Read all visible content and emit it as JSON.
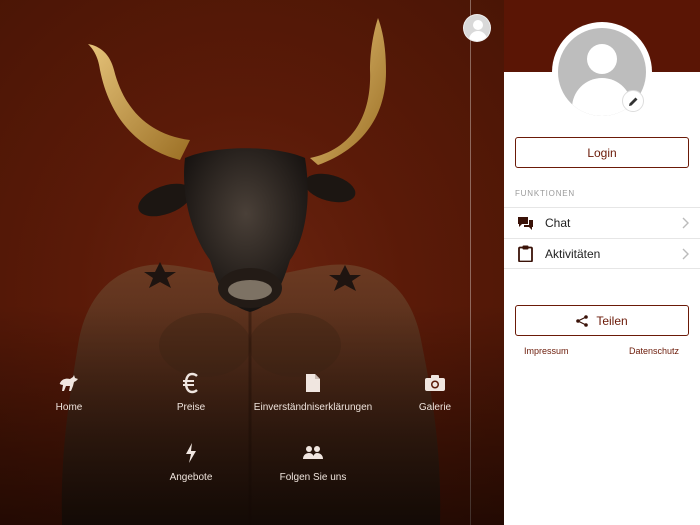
{
  "nav": [
    {
      "label": "Home",
      "icon": "bull-icon"
    },
    {
      "label": "Preise",
      "icon": "euro-icon"
    },
    {
      "label": "Einverständniserklärungen",
      "icon": "document-icon"
    },
    {
      "label": "Galerie",
      "icon": "camera-icon"
    },
    {
      "label": "Angebote",
      "icon": "bolt-icon"
    },
    {
      "label": "Folgen Sie uns",
      "icon": "users-icon"
    }
  ],
  "panel": {
    "login_label": "Login",
    "section_title": "FUNKTIONEN",
    "menu": [
      {
        "label": "Chat",
        "icon": "chat-icon"
      },
      {
        "label": "Aktivitäten",
        "icon": "clipboard-icon"
      }
    ],
    "share_label": "Teilen",
    "links": {
      "imprint": "Impressum",
      "privacy": "Datenschutz"
    }
  },
  "colors": {
    "brand": "#5a1505",
    "accent": "#6b1a08",
    "panel_bg": "#ffffff"
  }
}
